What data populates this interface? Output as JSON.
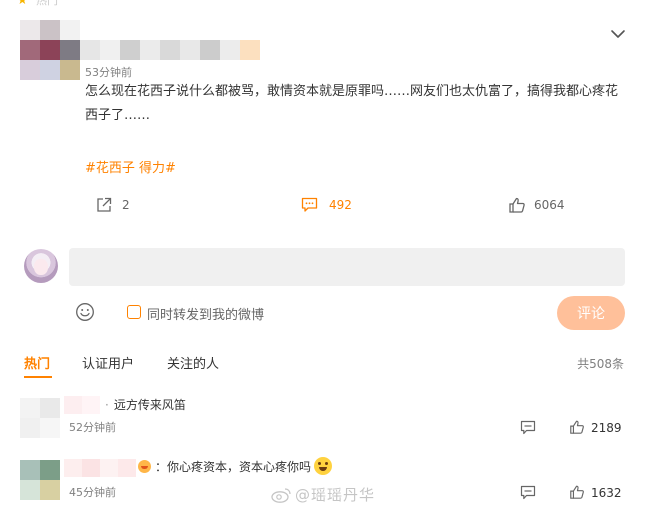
{
  "top_strip": {
    "label": "热门",
    "accent": "#f7b500"
  },
  "post": {
    "avatar_tiles": [
      "#ece8ea",
      "#cbc2c6",
      "#f2f2f2",
      "#a1697a",
      "#8c4358",
      "#7e7b84",
      "#d8cddb",
      "#cfd2e2",
      "#c9b98f"
    ],
    "name_tiles": [
      "#e6e6e6",
      "#f0f0f0",
      "#cfcfcf",
      "#ebebeb",
      "#d9d9d9",
      "#e8e8e8",
      "#cccccc",
      "#ececec",
      "#fce0bf"
    ],
    "time": "53分钟前",
    "text": "怎么现在花西子说什么都被骂，敢情资本就是原罪吗……网友们也太仇富了，搞得我都心疼花西子了……",
    "tags": "#花西子 得力#",
    "actions": {
      "share_count": "2",
      "comment_count": "492",
      "like_count": "6064"
    },
    "accent": "#ff8200"
  },
  "composer": {
    "placeholder": "",
    "repost_label": "同时转发到我的微博",
    "submit_label": "评论",
    "submit_color": "#ffc09a"
  },
  "tabs": [
    {
      "label": "热门",
      "active": true
    },
    {
      "label": "认证用户",
      "active": false
    },
    {
      "label": "关注的人",
      "active": false
    }
  ],
  "comment_count": "共508条",
  "comments": [
    {
      "avatar_tiles": [
        "#f3f3f3",
        "#e9e9e9",
        "#f0f0f0",
        "#f6f6f6"
      ],
      "name_tiles": [
        "#fdeef0",
        "#fff4f6"
      ],
      "text": "远方传来风笛",
      "separator": "·",
      "time": "52分钟前",
      "likes": "2189"
    },
    {
      "avatar_tiles": [
        "#a8c0b8",
        "#7c9e88",
        "#d6e4d9",
        "#d8d0a2"
      ],
      "name_tiles": [
        "#fdeeee",
        "#fbe3e4",
        "#fdf2f2",
        "#fde9ea"
      ],
      "text": "：你心疼资本，资本心疼你吗",
      "time": "45分钟前",
      "likes": "1632"
    }
  ],
  "watermark": "@瑶瑶丹华"
}
